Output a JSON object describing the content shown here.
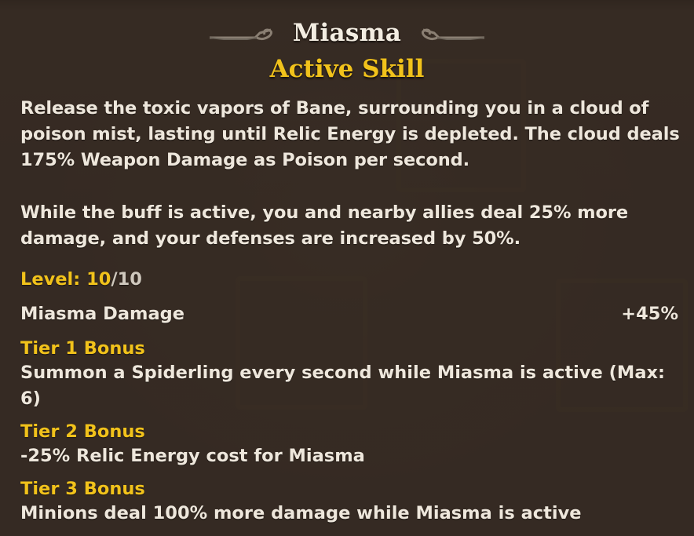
{
  "skill": {
    "name": "Miasma",
    "type": "Active Skill",
    "description": [
      "Release the toxic vapors of Bane, surrounding you in a cloud of poison mist, lasting until Relic Energy is depleted. The cloud deals 175% Weapon Damage as Poison per second.",
      "While the buff is active, you and nearby allies deal 25% more damage, and your defenses are increased by 50%."
    ],
    "level": {
      "label": "Level: 10",
      "max": "/10"
    },
    "stat": {
      "name": "Miasma Damage",
      "value": "+45%"
    },
    "tiers": [
      {
        "title": "Tier 1 Bonus",
        "text": "Summon a Spiderling every second while Miasma is active (Max: 6)"
      },
      {
        "title": "Tier 2 Bonus",
        "text": "-25% Relic Energy cost for Miasma"
      },
      {
        "title": "Tier 3 Bonus",
        "text": "Minions deal 100% more damage while Miasma is active"
      }
    ]
  },
  "colors": {
    "title": "#f3ede2",
    "accent_gold": "#f1c21b",
    "body_text": "#eee7dc",
    "panel_bg": "#3a3027"
  },
  "icons": {
    "left_ornament": "scroll-ornament-left-icon",
    "right_ornament": "scroll-ornament-right-icon"
  }
}
